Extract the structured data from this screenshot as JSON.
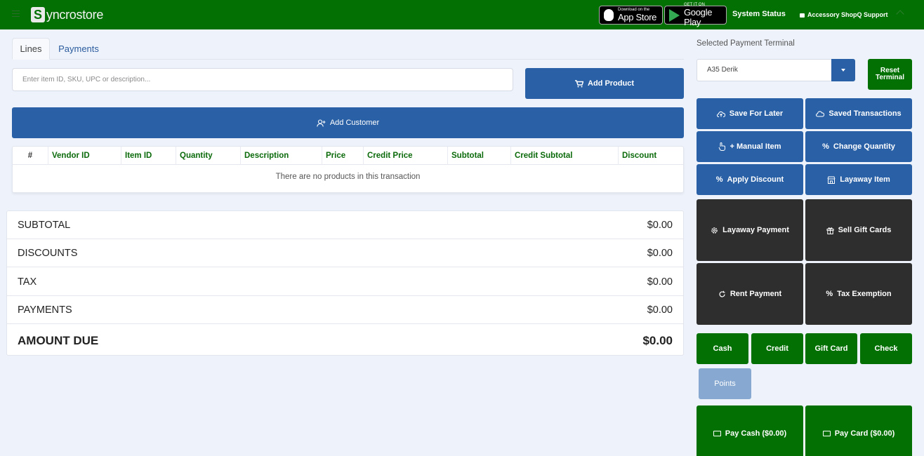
{
  "header": {
    "logo_text": "yncrostore",
    "logo_letter": "S",
    "app_store": {
      "small": "Download on the",
      "large": "App Store"
    },
    "google_play": {
      "small": "GET IT ON",
      "large": "Google Play"
    },
    "system_status": "System Status",
    "support": "Accessory ShopQ Support"
  },
  "tabs": [
    {
      "label": "Lines",
      "active": true
    },
    {
      "label": "Payments",
      "active": false
    }
  ],
  "search": {
    "placeholder": "Enter item ID, SKU, UPC or description..."
  },
  "buttons": {
    "add_product": "Add Product",
    "add_customer": "Add Customer"
  },
  "table": {
    "columns": [
      "#",
      "Vendor ID",
      "Item ID",
      "Quantity",
      "Description",
      "Price",
      "Credit Price",
      "Subtotal",
      "Credit Subtotal",
      "Discount"
    ],
    "empty_message": "There are no products in this transaction"
  },
  "totals": [
    {
      "label": "SUBTOTAL",
      "value": "$0.00"
    },
    {
      "label": "DISCOUNTS",
      "value": "$0.00"
    },
    {
      "label": "TAX",
      "value": "$0.00"
    },
    {
      "label": "PAYMENTS",
      "value": "$0.00"
    }
  ],
  "amount_due": {
    "label": "AMOUNT DUE",
    "value": "$0.00"
  },
  "terminal": {
    "label": "Selected Payment Terminal",
    "selected": "A35 Derik",
    "reset_line1": "Reset",
    "reset_line2": "Terminal"
  },
  "actions": {
    "save_for_later": "Save For Later",
    "saved_transactions": "Saved Transactions",
    "manual_item": "+ Manual Item",
    "change_quantity": "Change Quantity",
    "apply_discount": "Apply Discount",
    "layaway_item": "Layaway Item",
    "layaway_payment": "Layaway Payment",
    "sell_gift_cards": "Sell Gift Cards",
    "rent_payment": "Rent Payment",
    "tax_exemption": "Tax Exemption"
  },
  "payment_methods": {
    "cash": "Cash",
    "credit": "Credit",
    "gift_card": "Gift Card",
    "check": "Check",
    "points": "Points"
  },
  "pay": {
    "cash": "Pay Cash ($0.00)",
    "card": "Pay Card ($0.00)"
  },
  "colors": {
    "primary_green": "#037003",
    "primary_blue": "#2a60a5",
    "dark": "#2e2e2e",
    "background": "#eef2fa"
  }
}
